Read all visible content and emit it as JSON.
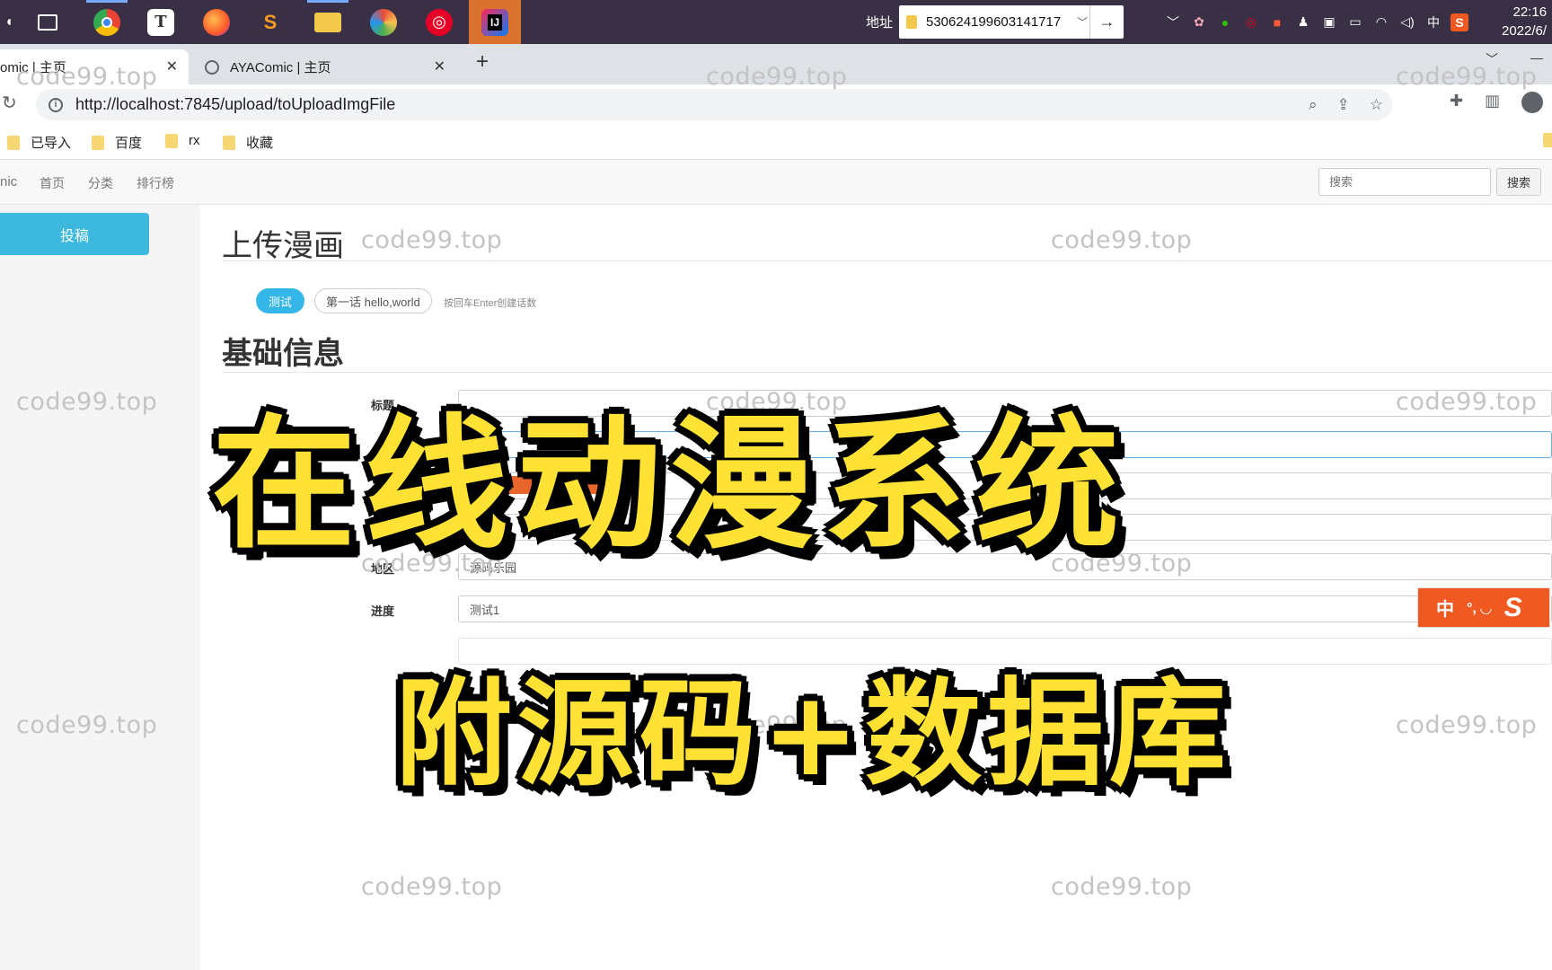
{
  "taskbar": {
    "address_label": "地址",
    "address_value": "530624199603141717",
    "go_glyph": "→",
    "clock_time": "22:16",
    "clock_date": "2022/6/",
    "apps": [
      "task-view-icon",
      "chrome-icon",
      "typora-icon",
      "firefox-icon",
      "sublime-icon",
      "file-explorer-icon",
      "color-picker-icon",
      "netease-music-icon",
      "intellij-icon"
    ],
    "tray_ime": "中"
  },
  "browser": {
    "tabs": [
      {
        "title": "omic | 主页"
      },
      {
        "title": "AYAComic | 主页"
      }
    ],
    "url": "http://localhost:7845/upload/toUploadImgFile",
    "bookmarks": [
      "已导入",
      "百度",
      "rx",
      "收藏"
    ]
  },
  "navbar": {
    "brand": "nic",
    "links": [
      "首页",
      "分类",
      "排行榜"
    ],
    "search_placeholder": "搜索",
    "search_button": "搜索"
  },
  "sidebar": {
    "contribute_button": "投稿"
  },
  "main": {
    "upload_heading": "上传漫画",
    "chip_selected": "测试",
    "chip_chapter": "第一话 hello,world",
    "chip_hint": "按回车Enter创建话数",
    "basic_heading": "基础信息",
    "fields": {
      "title_label": "标题",
      "region_label": "地区",
      "region_value": "源码乐园",
      "progress_label": "进度",
      "progress_value": "测试1"
    }
  },
  "ime_widget": {
    "label": "中",
    "punct": "°, ◡",
    "logo": "S"
  },
  "overlay": {
    "line1": "在线动漫系统",
    "line2": "附源码+数据库"
  },
  "watermark": "code99.top",
  "colors": {
    "accent": "#35b6e8",
    "taskbar": "#3a3045",
    "banner": "#ffe233",
    "ime": "#f05a22"
  }
}
